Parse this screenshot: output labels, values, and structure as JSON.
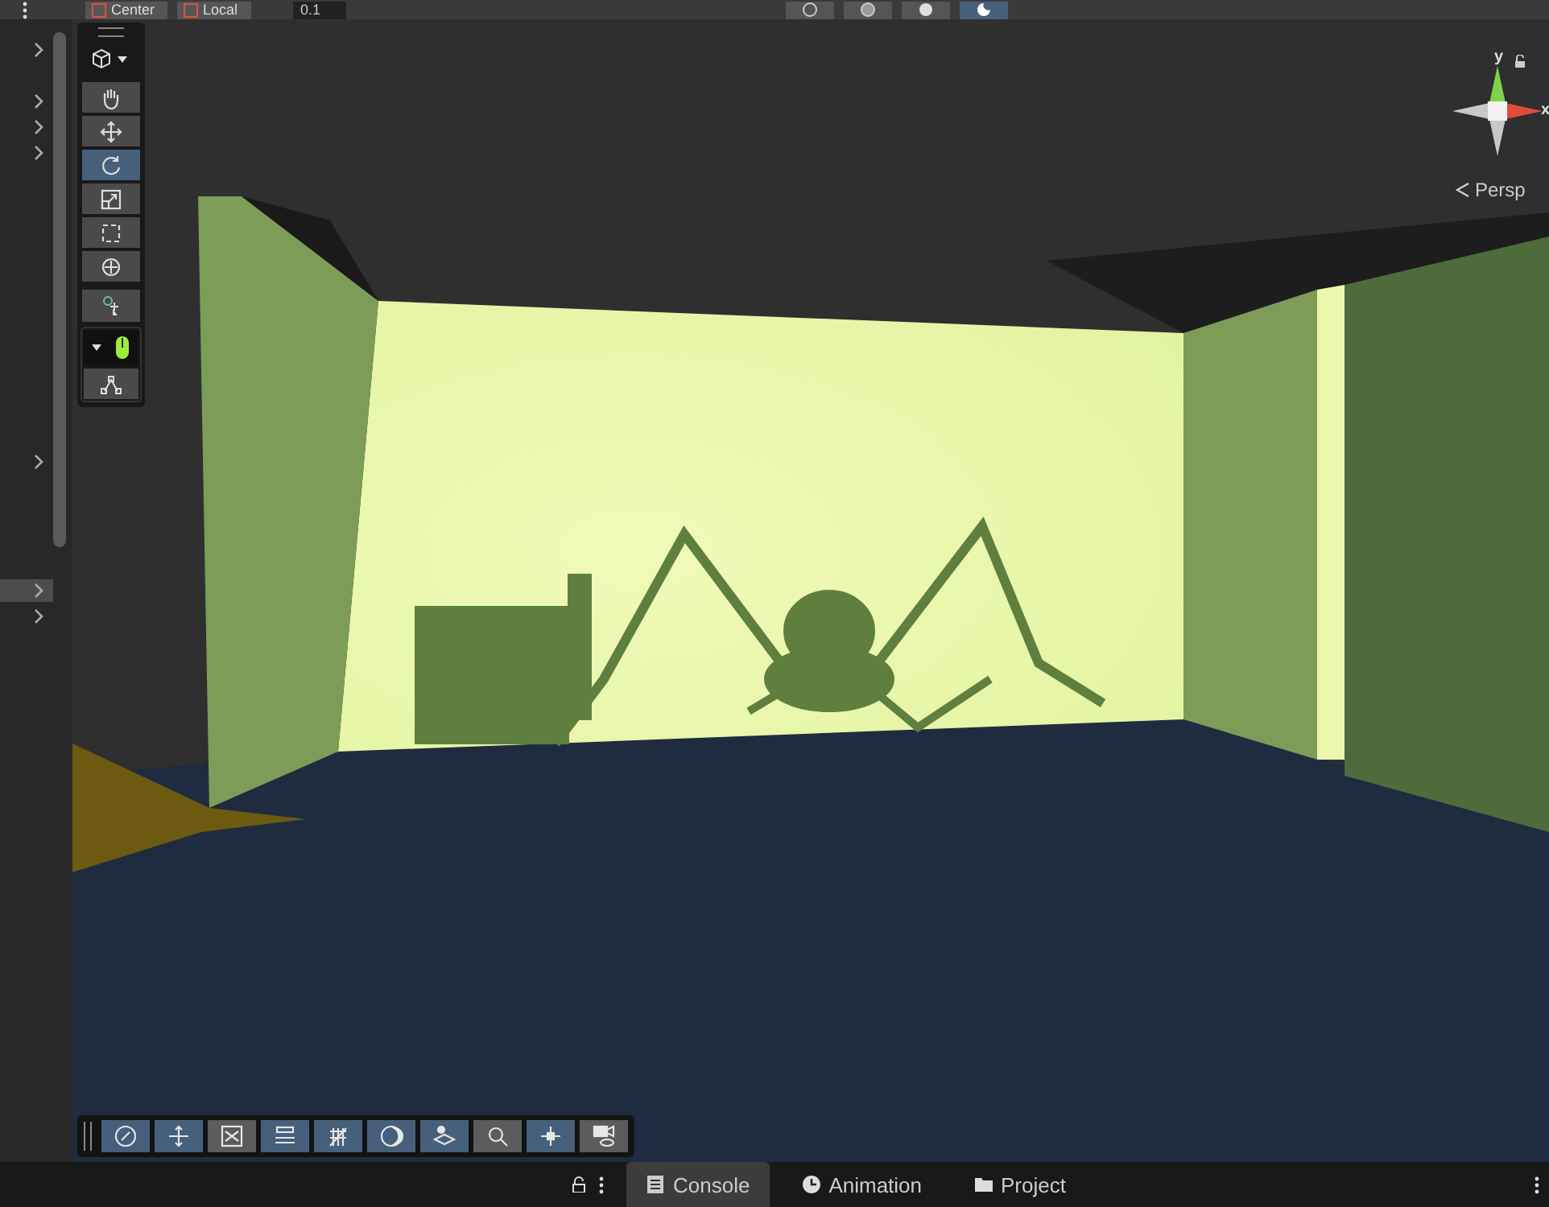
{
  "top_toolbar": {
    "pivot_mode": "Center",
    "pivot_rotation": "Local",
    "snap_value": "0.1",
    "view_buttons": [
      {
        "kind": "wire",
        "selected": false
      },
      {
        "kind": "shaded-wire",
        "selected": false
      },
      {
        "kind": "shaded",
        "selected": false
      },
      {
        "kind": "lit",
        "selected": true
      }
    ]
  },
  "hierarchy": {
    "rows": [
      {
        "expanded": false,
        "selected": false
      },
      {
        "expanded": false,
        "selected": false
      },
      {
        "expanded": false,
        "selected": false
      },
      {
        "expanded": false,
        "selected": false
      },
      {
        "expanded": false,
        "selected": false
      },
      {
        "expanded": false,
        "selected": true
      },
      {
        "expanded": false,
        "selected": false
      }
    ]
  },
  "tools": [
    {
      "kind": "hand",
      "selected": false
    },
    {
      "kind": "move",
      "selected": false
    },
    {
      "kind": "rotate",
      "selected": true
    },
    {
      "kind": "scale",
      "selected": false
    },
    {
      "kind": "rect",
      "selected": false
    },
    {
      "kind": "transform",
      "selected": false
    }
  ],
  "gizmo": {
    "y_label": "y",
    "x_label": "x",
    "projection": "Persp"
  },
  "overlay_toolbar": [
    {
      "kind": "compass",
      "on": true
    },
    {
      "kind": "move",
      "on": true
    },
    {
      "kind": "scale",
      "on": false
    },
    {
      "kind": "sliders",
      "on": true
    },
    {
      "kind": "grid",
      "on": true
    },
    {
      "kind": "moon",
      "on": true
    },
    {
      "kind": "layers",
      "on": true
    },
    {
      "kind": "search",
      "on": false
    },
    {
      "kind": "nodes",
      "on": true
    },
    {
      "kind": "camera",
      "on": false
    }
  ],
  "bottom_tabs": [
    {
      "label": "Console",
      "kind": "list",
      "selected": true
    },
    {
      "label": "Animation",
      "kind": "clock",
      "selected": false
    },
    {
      "label": "Project",
      "kind": "folder",
      "selected": false
    }
  ]
}
